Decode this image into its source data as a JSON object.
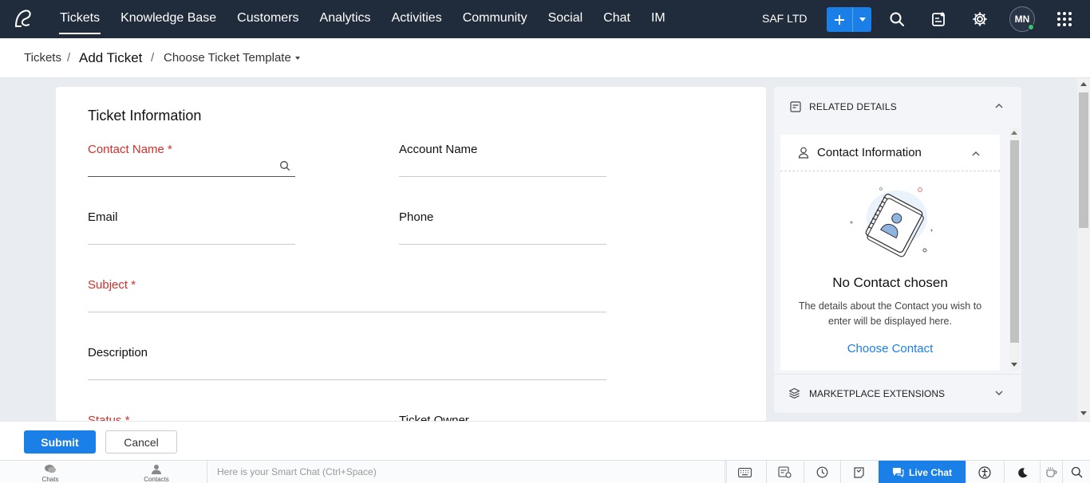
{
  "nav": {
    "items": [
      "Tickets",
      "Knowledge Base",
      "Customers",
      "Analytics",
      "Activities",
      "Community",
      "Social",
      "Chat",
      "IM"
    ],
    "active": "Tickets",
    "org": "SAF LTD",
    "avatar_initials": "MN"
  },
  "breadcrumb": {
    "root": "Tickets",
    "sep": "/",
    "current": "Add Ticket",
    "template": "Choose Ticket Template"
  },
  "form": {
    "section_title": "Ticket Information",
    "contact_name": "Contact Name *",
    "account_name": "Account Name",
    "email": "Email",
    "phone": "Phone",
    "subject": "Subject *",
    "description": "Description",
    "status": "Status *",
    "ticket_owner": "Ticket Owner"
  },
  "related": {
    "header": "RELATED DETAILS",
    "contact_title": "Contact Information",
    "empty_title": "No Contact chosen",
    "empty_text": "The details about the Contact you wish to enter will be displayed here.",
    "choose_link": "Choose Contact",
    "marketplace": "MARKETPLACE EXTENSIONS"
  },
  "actions": {
    "submit": "Submit",
    "cancel": "Cancel"
  },
  "bottom": {
    "chats": "Chats",
    "contacts": "Contacts",
    "smart_chat_placeholder": "Here is your Smart Chat (Ctrl+Space)",
    "live_chat": "Live Chat"
  },
  "colors": {
    "topbar": "#202b3c",
    "accent": "#1b7fe8",
    "required": "#d0312d"
  }
}
